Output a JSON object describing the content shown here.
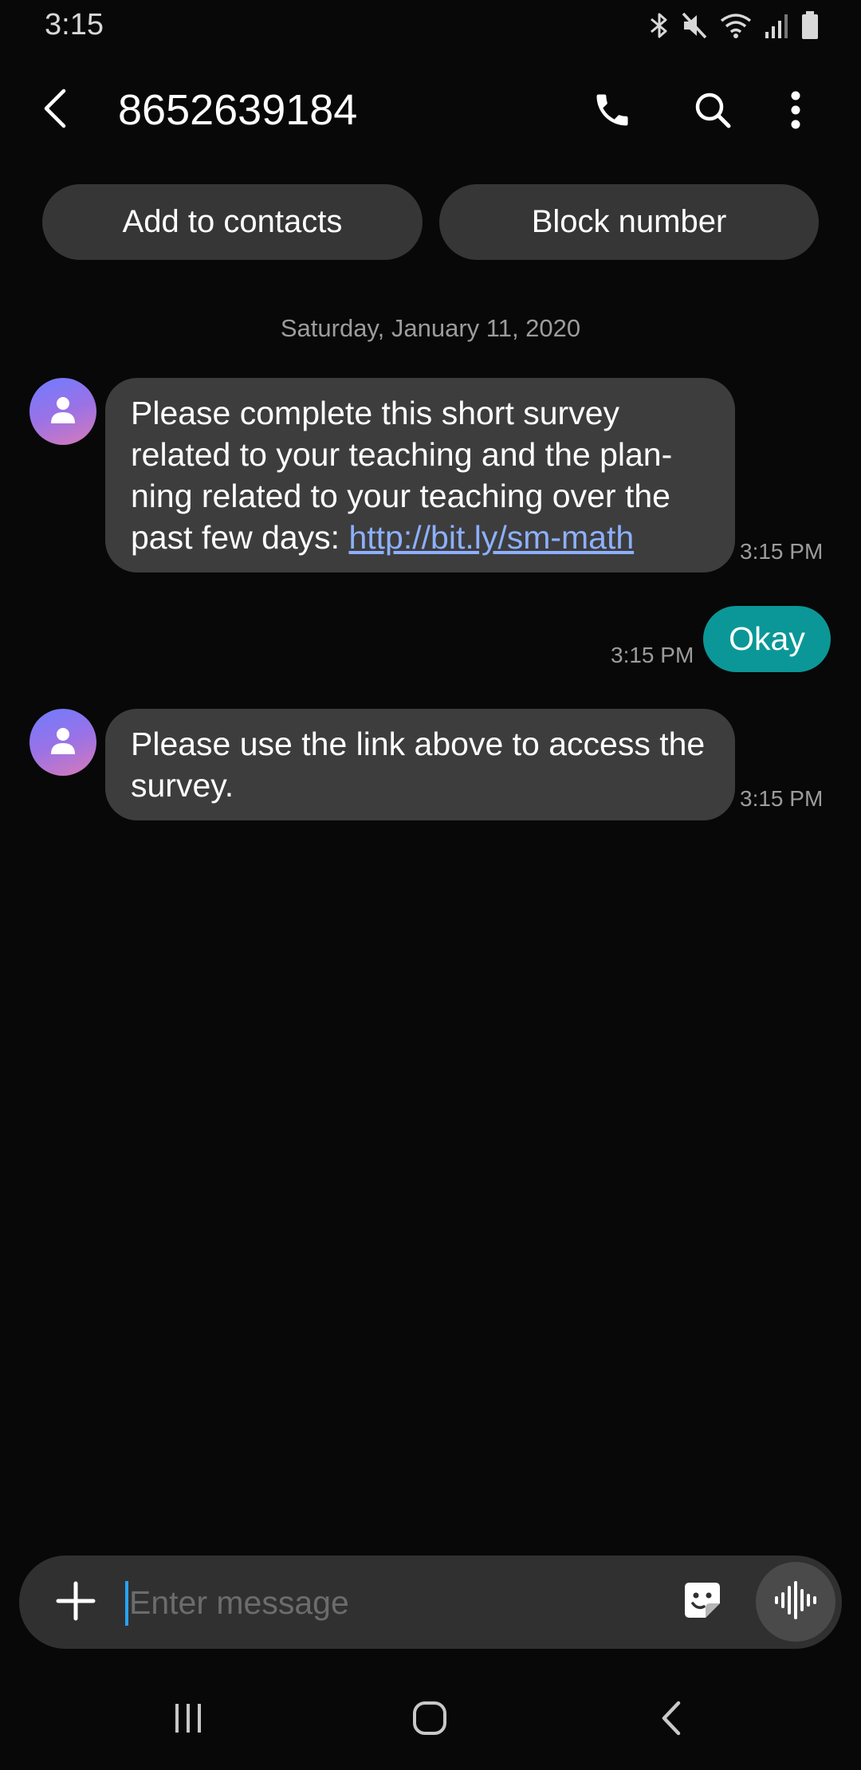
{
  "status_bar": {
    "time": "3:15",
    "icons": [
      "bluetooth-icon",
      "mute-icon",
      "wifi-icon",
      "signal-icon",
      "battery-icon"
    ]
  },
  "header": {
    "title": "8652639184",
    "icons": [
      "back-arrow-icon",
      "phone-icon",
      "search-icon",
      "more-vertical-icon"
    ]
  },
  "actions": {
    "add_to_contacts": "Add to contacts",
    "block_number": "Block number"
  },
  "conversation": {
    "date": "Saturday, January 11, 2020",
    "messages": [
      {
        "direction": "incoming",
        "text_before_link": "Please complete this short survey related to your teaching and the plan-ning related to your teaching over the past few days: ",
        "link": "http://bit.ly/sm-math",
        "time": "3:15 PM"
      },
      {
        "direction": "outgoing",
        "text": "Okay",
        "time": "3:15 PM"
      },
      {
        "direction": "incoming",
        "text": "Please use the link above to access the survey.",
        "time": "3:15 PM"
      }
    ]
  },
  "composer": {
    "placeholder": "Enter message",
    "value": "",
    "icons": [
      "plus-icon",
      "sticker-icon",
      "voice-record-icon"
    ]
  },
  "nav_bar": {
    "icons": [
      "recents-icon",
      "home-icon",
      "nav-back-icon"
    ]
  },
  "colors": {
    "background": "#080808",
    "incoming_bubble": "#3d3d3d",
    "outgoing_bubble": "#0b9797",
    "link": "#8db0ff",
    "cursor": "#27a3f5"
  }
}
